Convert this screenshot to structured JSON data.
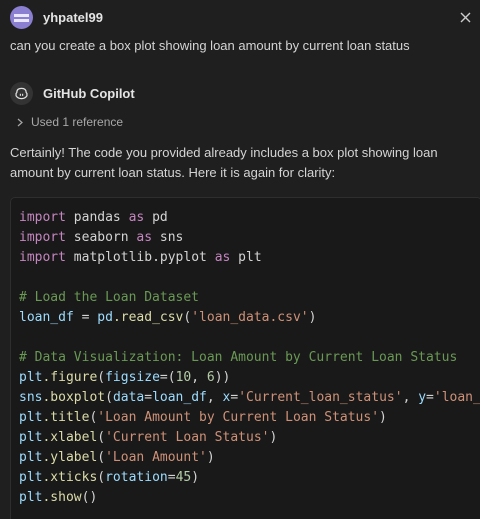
{
  "user": {
    "name": "yhpatel99",
    "message": "can you create a box plot showing loan amount by current loan status"
  },
  "assistant": {
    "name": "GitHub Copilot",
    "references_label": "Used 1 reference",
    "answer_line1": "Certainly! The code you provided already includes a box plot showing loan",
    "answer_line2": "amount by current loan status. Here it is again for clarity:"
  },
  "code": {
    "l1": {
      "kw": "import",
      "mod": "pandas",
      "as": "as",
      "alias": "pd"
    },
    "l2": {
      "kw": "import",
      "mod": "seaborn",
      "as": "as",
      "alias": "sns"
    },
    "l3": {
      "kw": "import",
      "mod": "matplotlib.pyplot",
      "as": "as",
      "alias": "plt"
    },
    "l5": {
      "comment": "# Load the Loan Dataset"
    },
    "l6": {
      "var": "loan_df",
      "eq": " = ",
      "obj": "pd",
      "fn": ".read_csv",
      "open": "(",
      "str": "'loan_data.csv'",
      "close": ")"
    },
    "l8": {
      "comment": "# Data Visualization: Loan Amount by Current Loan Status"
    },
    "l9": {
      "obj": "plt",
      "fn": ".figure",
      "open": "(",
      "arg": "figsize",
      "eq": "=(",
      "n1": "10",
      "sep": ", ",
      "n2": "6",
      "close": "))"
    },
    "l10": {
      "obj": "sns",
      "fn": ".boxplot",
      "open": "(",
      "arg1": "data",
      "eq1": "=",
      "v1": "loan_df",
      "sep1": ", ",
      "arg2": "x",
      "eq2": "=",
      "s2": "'Current_loan_status'",
      "sep2": ", ",
      "arg3": "y",
      "eq3": "=",
      "s3": "'loan_"
    },
    "l11": {
      "obj": "plt",
      "fn": ".title",
      "open": "(",
      "str": "'Loan Amount by Current Loan Status'",
      "close": ")"
    },
    "l12": {
      "obj": "plt",
      "fn": ".xlabel",
      "open": "(",
      "str": "'Current Loan Status'",
      "close": ")"
    },
    "l13": {
      "obj": "plt",
      "fn": ".ylabel",
      "open": "(",
      "str": "'Loan Amount'",
      "close": ")"
    },
    "l14": {
      "obj": "plt",
      "fn": ".xticks",
      "open": "(",
      "arg": "rotation",
      "eq": "=",
      "num": "45",
      "close": ")"
    },
    "l15": {
      "obj": "plt",
      "fn": ".show",
      "parens": "()"
    }
  },
  "icons": {
    "close": "close-icon",
    "chevron": "chevron-right-icon",
    "copilot": "copilot-icon",
    "avatar": "user-avatar"
  }
}
